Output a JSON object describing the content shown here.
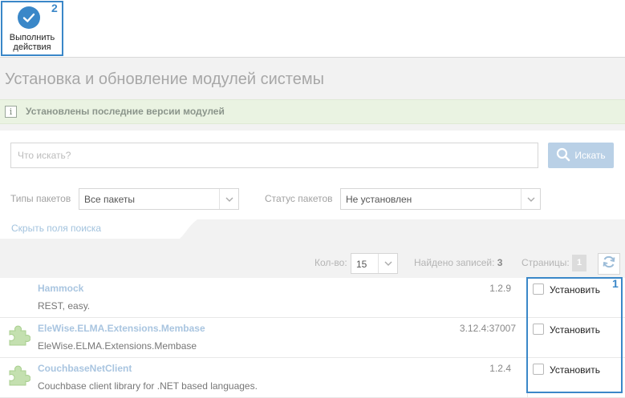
{
  "toolbar": {
    "action_label_line1": "Выполнить",
    "action_label_line2": "действия",
    "action_icon": "check-icon",
    "badge": "2"
  },
  "page": {
    "title": "Установка и обновление модулей системы"
  },
  "info": {
    "icon": "info-icon",
    "text": "Установлены последние версии модулей"
  },
  "search": {
    "placeholder": "Что искать?",
    "value": "",
    "button_label": "Искать",
    "button_icon": "search-icon"
  },
  "filters": {
    "package_types_label": "Типы пакетов",
    "package_types_value": "Все пакеты",
    "package_status_label": "Статус пакетов",
    "package_status_value": "Не установлен",
    "hide_fields_label": "Скрыть поля поиска"
  },
  "pager": {
    "count_label": "Кол-во:",
    "count_value": "15",
    "found_label": "Найдено записей:",
    "found_value": "3",
    "pages_label": "Страницы:",
    "current_page": "1",
    "refresh_icon": "refresh-icon"
  },
  "packages": [
    {
      "name": "Hammock",
      "description": "REST, easy.",
      "version": "1.2.9",
      "install_label": "Установить",
      "checked": false,
      "has_icon": false
    },
    {
      "name": "EleWise.ELMA.Extensions.Membase",
      "description": "EleWise.ELMA.Extensions.Membase",
      "version": "3.12.4:37007",
      "install_label": "Установить",
      "checked": false,
      "has_icon": true
    },
    {
      "name": "CouchbaseNetClient",
      "description": "Couchbase client library for .NET based languages.",
      "version": "1.2.4",
      "install_label": "Установить",
      "checked": false,
      "has_icon": true
    }
  ],
  "annotations": {
    "badge_1": "1"
  },
  "colors": {
    "accent": "#3a87c8",
    "link": "#a9c5e0",
    "banner_bg": "#eaf3e2",
    "search_button": "#b9d0e6"
  }
}
